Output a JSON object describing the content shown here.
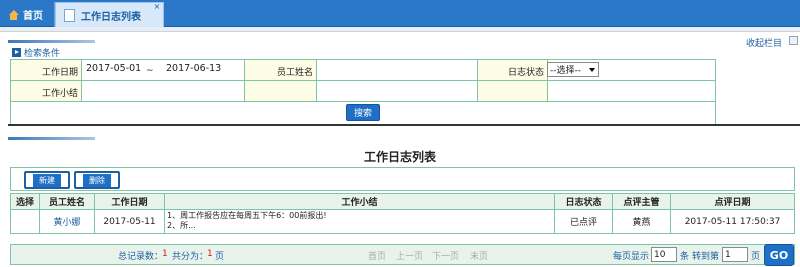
{
  "tabs": [
    {
      "label": "首页",
      "icon": "home-icon"
    },
    {
      "label": "工作日志列表",
      "icon": "document-icon",
      "close": "×"
    }
  ],
  "search": {
    "title": "检索条件",
    "collapse_label": "收起栏目",
    "labels": {
      "work_date": "工作日期",
      "employee_name": "员工姓名",
      "log_status": "日志状态",
      "work_summary": "工作小结"
    },
    "date_from": "2017-05-01",
    "date_sep": "~",
    "date_to": "2017-06-13",
    "employee_name_value": "",
    "work_summary_value": "",
    "status_selected": "--选择--",
    "search_button": "搜索"
  },
  "list": {
    "title": "工作日志列表",
    "new_button": "新建",
    "delete_button": "删除",
    "columns": [
      "选择",
      "员工姓名",
      "工作日期",
      "工作小结",
      "日志状态",
      "点评主管",
      "点评日期"
    ],
    "rows": [
      {
        "name": "黄小娜",
        "date": "2017-05-11",
        "summary_line1": "1、周工作报告应在每周五下午6：00前报出!",
        "summary_line2": "2、所...",
        "status": "已点评",
        "reviewer": "黄燕",
        "review_date": "2017-05-11 17:50:37"
      }
    ]
  },
  "pager": {
    "total_label": "总记录数：",
    "total": "1",
    "pages_label": "共分为：",
    "pages": "1",
    "pages_unit": "页",
    "first": "首页",
    "prev": "上一页",
    "next": "下一页",
    "last": "末页",
    "per_page_label": "每页显示",
    "per_page": "10",
    "per_page_unit": "条",
    "goto_label": "转到第",
    "goto_page": "1",
    "goto_unit": "页",
    "go": "GO"
  },
  "colors": {
    "accent": "#2b78c8",
    "border": "#7fc4a4",
    "cell_bg": "#fdfde6",
    "header_bg": "#e8f3ec"
  }
}
